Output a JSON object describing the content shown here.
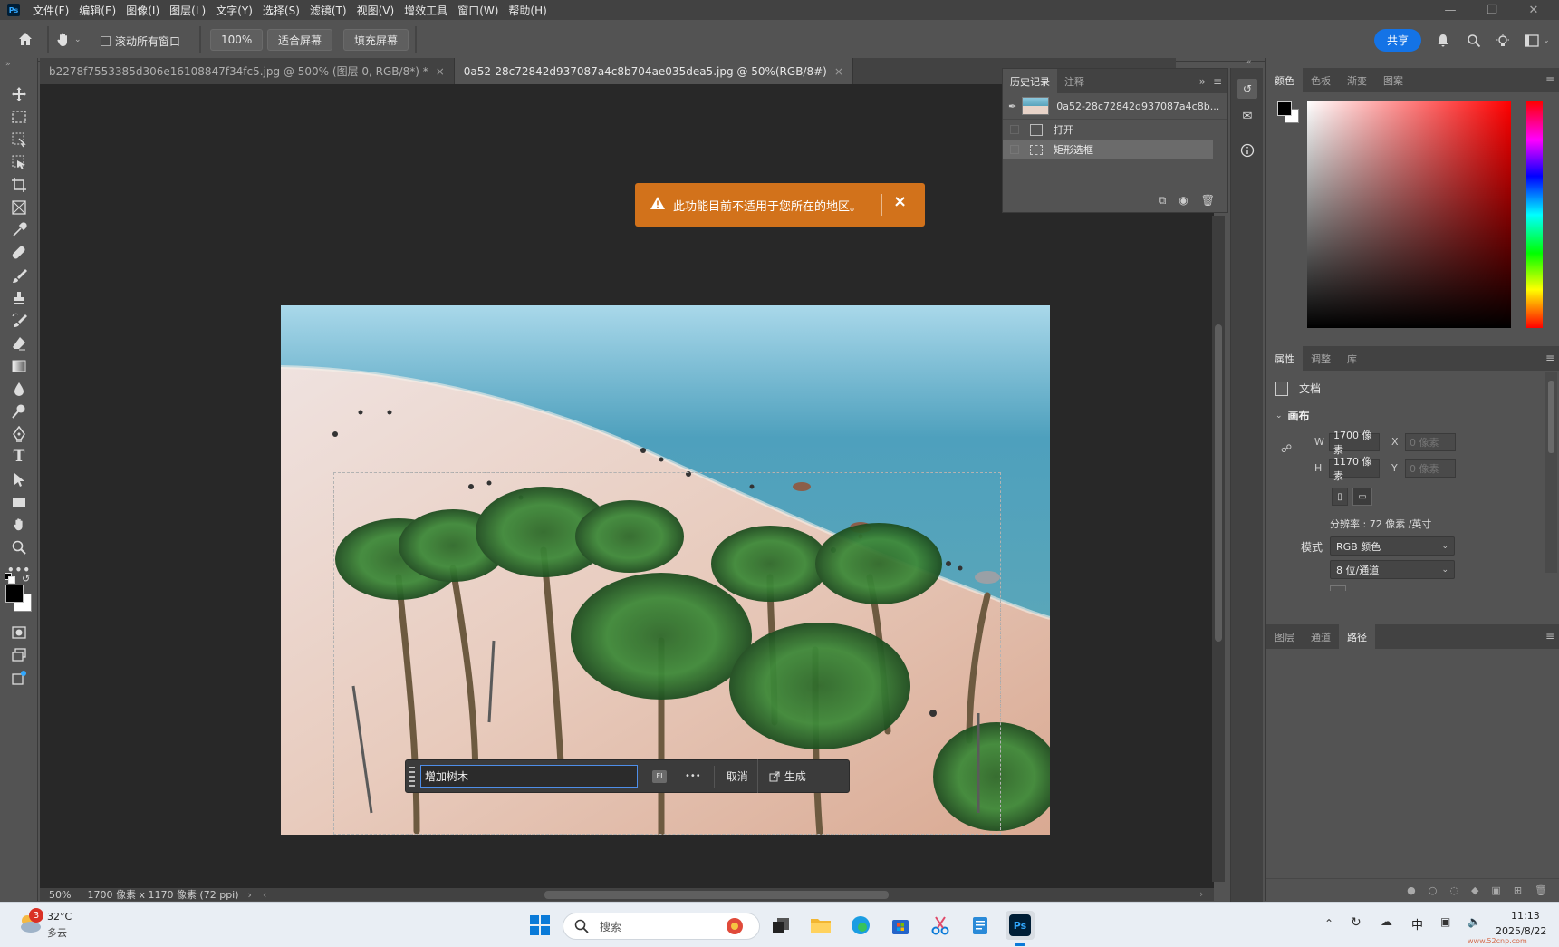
{
  "app": {
    "logo": "Ps",
    "menu": [
      "文件(F)",
      "编辑(E)",
      "图像(I)",
      "图层(L)",
      "文字(Y)",
      "选择(S)",
      "滤镜(T)",
      "视图(V)",
      "增效工具",
      "窗口(W)",
      "帮助(H)"
    ]
  },
  "options": {
    "scroll_all_label": "滚动所有窗口",
    "zoom_value": "100%",
    "fit_screen": "适合屏幕",
    "fill_screen": "填充屏幕",
    "share": "共享"
  },
  "tabs": [
    {
      "label": "b2278f7553385d306e16108847f34fc5.jpg @ 500% (图层 0, RGB/8*) *",
      "active": false
    },
    {
      "label": "0a52-28c72842d937087a4c8b704ae035dea5.jpg @ 50%(RGB/8#)",
      "active": true
    }
  ],
  "toast": {
    "message": "此功能目前不适用于您所在的地区。"
  },
  "context_bar": {
    "prompt_value": "增加树木",
    "badge": "FI",
    "more": "•••",
    "cancel": "取消",
    "generate": "生成"
  },
  "status": {
    "zoom": "50%",
    "doc_info": "1700 像素 x 1170 像素 (72 ppi)"
  },
  "history": {
    "tabs": [
      "历史记录",
      "注释"
    ],
    "snapshot_label": "0a52-28c72842d937087a4c8b...",
    "steps": [
      "打开",
      "矩形选框"
    ]
  },
  "color_panel": {
    "tabs": [
      "颜色",
      "色板",
      "渐变",
      "图案"
    ]
  },
  "properties": {
    "tabs": [
      "属性",
      "调整",
      "库"
    ],
    "doc_label": "文档",
    "section": "画布",
    "w_label": "W",
    "w_value": "1700 像素",
    "h_label": "H",
    "h_value": "1170 像素",
    "x_label": "X",
    "x_value": "0 像素",
    "y_label": "Y",
    "y_value": "0 像素",
    "resolution": "分辨率 : 72 像素 /英寸",
    "mode_label": "模式",
    "mode_value": "RGB 颜色",
    "depth_value": "8 位/通道"
  },
  "layers_panel": {
    "tabs": [
      "图层",
      "通道",
      "路径"
    ]
  },
  "taskbar": {
    "weather_badge": "3",
    "temperature": "32°C",
    "weather": "多云",
    "search_placeholder": "搜索",
    "ime": "中",
    "time": "11:13",
    "date": "2025/8/22",
    "watermark": "www.52cnp.com"
  }
}
